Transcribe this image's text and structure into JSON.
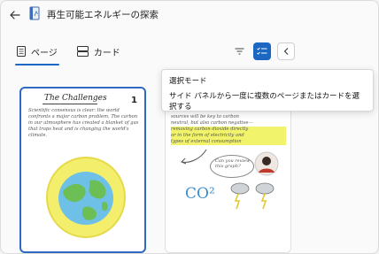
{
  "header": {
    "title": "再生可能エネルギーの探索"
  },
  "tabs": [
    {
      "label": "ページ",
      "selected": true
    },
    {
      "label": "カード",
      "selected": false
    }
  ],
  "tooltip": {
    "title": "選択モード",
    "body": "サイド パネルから一度に複数のページまたはカードを選択する"
  },
  "pages": [
    {
      "number": "1",
      "title": "The Challenges",
      "text": "Scientific consensus is clear: the world confronts a major carbon problem. The carbon in our atmosphere has created a blanket of gas that traps heat and is changing the world's climate."
    },
    {
      "text_lines": [
        "sources will be key to carbon",
        "neutral, but also carbon negative—",
        "removing carbon dioxide directly",
        "or in the form of electricity and",
        "types of external consumption"
      ],
      "bubble_text": "Can you review this graph?",
      "co2_label": "CO²"
    }
  ],
  "colors": {
    "accent": "#1b67c1",
    "highlight": "#f1f36a"
  }
}
